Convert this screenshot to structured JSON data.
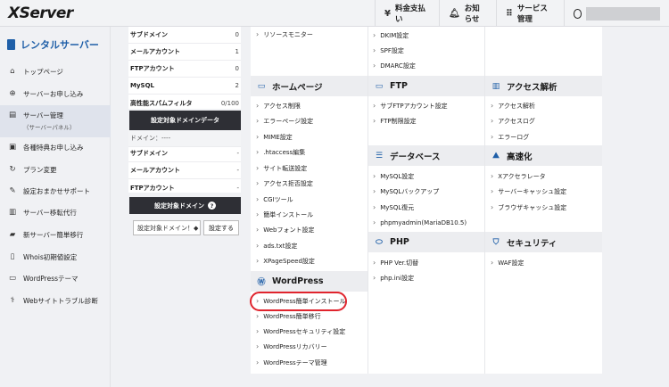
{
  "header": {
    "logo": "XServer",
    "billing": "料金支払い",
    "notices": "お知らせ",
    "services": "サービス管理"
  },
  "sidebar": {
    "title": "レンタルサーバー",
    "items": [
      {
        "label": "トップページ",
        "icon": "home-icon"
      },
      {
        "label": "サーバーお申し込み",
        "icon": "plus-circle-icon"
      },
      {
        "label": "サーバー管理",
        "sub": "（サーバーパネル）",
        "icon": "server-icon"
      },
      {
        "label": "各種特典お申し込み",
        "icon": "gift-icon"
      },
      {
        "label": "プラン変更",
        "icon": "refresh-icon"
      },
      {
        "label": "設定おまかせサポート",
        "icon": "wrench-icon"
      },
      {
        "label": "サーバー移転代行",
        "icon": "building-icon"
      },
      {
        "label": "新サーバー簡単移行",
        "icon": "truck-icon"
      },
      {
        "label": "Whois初期値設定",
        "icon": "document-icon"
      },
      {
        "label": "WordPressテーマ",
        "icon": "window-icon"
      },
      {
        "label": "Webサイトトラブル診断",
        "icon": "stethoscope-icon"
      }
    ]
  },
  "usage": [
    {
      "k": "サブドメイン",
      "v": "0"
    },
    {
      "k": "メールアカウント",
      "v": "1"
    },
    {
      "k": "FTPアカウント",
      "v": "0"
    },
    {
      "k": "MySQL",
      "v": "2"
    },
    {
      "k": "高性能スパムフィルタ",
      "v": "0/100"
    }
  ],
  "target": {
    "title": "設定対象ドメインデータ",
    "domain": "ドメイン：----",
    "rows": [
      {
        "k": "サブドメイン",
        "v": "-"
      },
      {
        "k": "メールアカウント",
        "v": "-"
      },
      {
        "k": "FTPアカウント",
        "v": "-"
      }
    ]
  },
  "domain_select": {
    "title": "設定対象ドメイン",
    "help": "?",
    "value": "設定対象ドメイン！◆",
    "button": "設定する"
  },
  "menu": {
    "top_left": [
      "リソースモニター"
    ],
    "top_mid": [
      "DKIM設定",
      "SPF設定",
      "DMARC設定"
    ],
    "homepage": {
      "title": "ホームページ",
      "items": [
        "アクセス制限",
        "エラーページ設定",
        "MIME設定",
        ".htaccess編集",
        "サイト転送設定",
        "アクセス拒否設定",
        "CGIツール",
        "簡単インストール",
        "Webフォント設定",
        "ads.txt設定",
        "XPageSpeed設定"
      ]
    },
    "ftp": {
      "title": "FTP",
      "items": [
        "サブFTPアカウント設定",
        "FTP制限設定"
      ]
    },
    "analytics": {
      "title": "アクセス解析",
      "items": [
        "アクセス解析",
        "アクセスログ",
        "エラーログ"
      ]
    },
    "database": {
      "title": "データベース",
      "items": [
        "MySQL設定",
        "MySQLバックアップ",
        "MySQL復元",
        "phpmyadmin(MariaDB10.5)"
      ]
    },
    "speed": {
      "title": "高速化",
      "items": [
        "Xアクセラレータ",
        "サーバーキャッシュ設定",
        "ブラウザキャッシュ設定"
      ]
    },
    "php": {
      "title": "PHP",
      "items": [
        "PHP Ver.切替",
        "php.ini設定"
      ]
    },
    "security": {
      "title": "セキュリティ",
      "items": [
        "WAF設定"
      ]
    },
    "wordpress": {
      "title": "WordPress",
      "items": [
        "WordPress簡単インストール",
        "WordPress簡単移行",
        "WordPressセキュリティ設定",
        "WordPressリカバリー",
        "WordPressテーマ管理"
      ]
    }
  },
  "colors": {
    "accent": "#1f5fa8",
    "highlight": "#e0242d",
    "dark": "#2e2f35"
  }
}
